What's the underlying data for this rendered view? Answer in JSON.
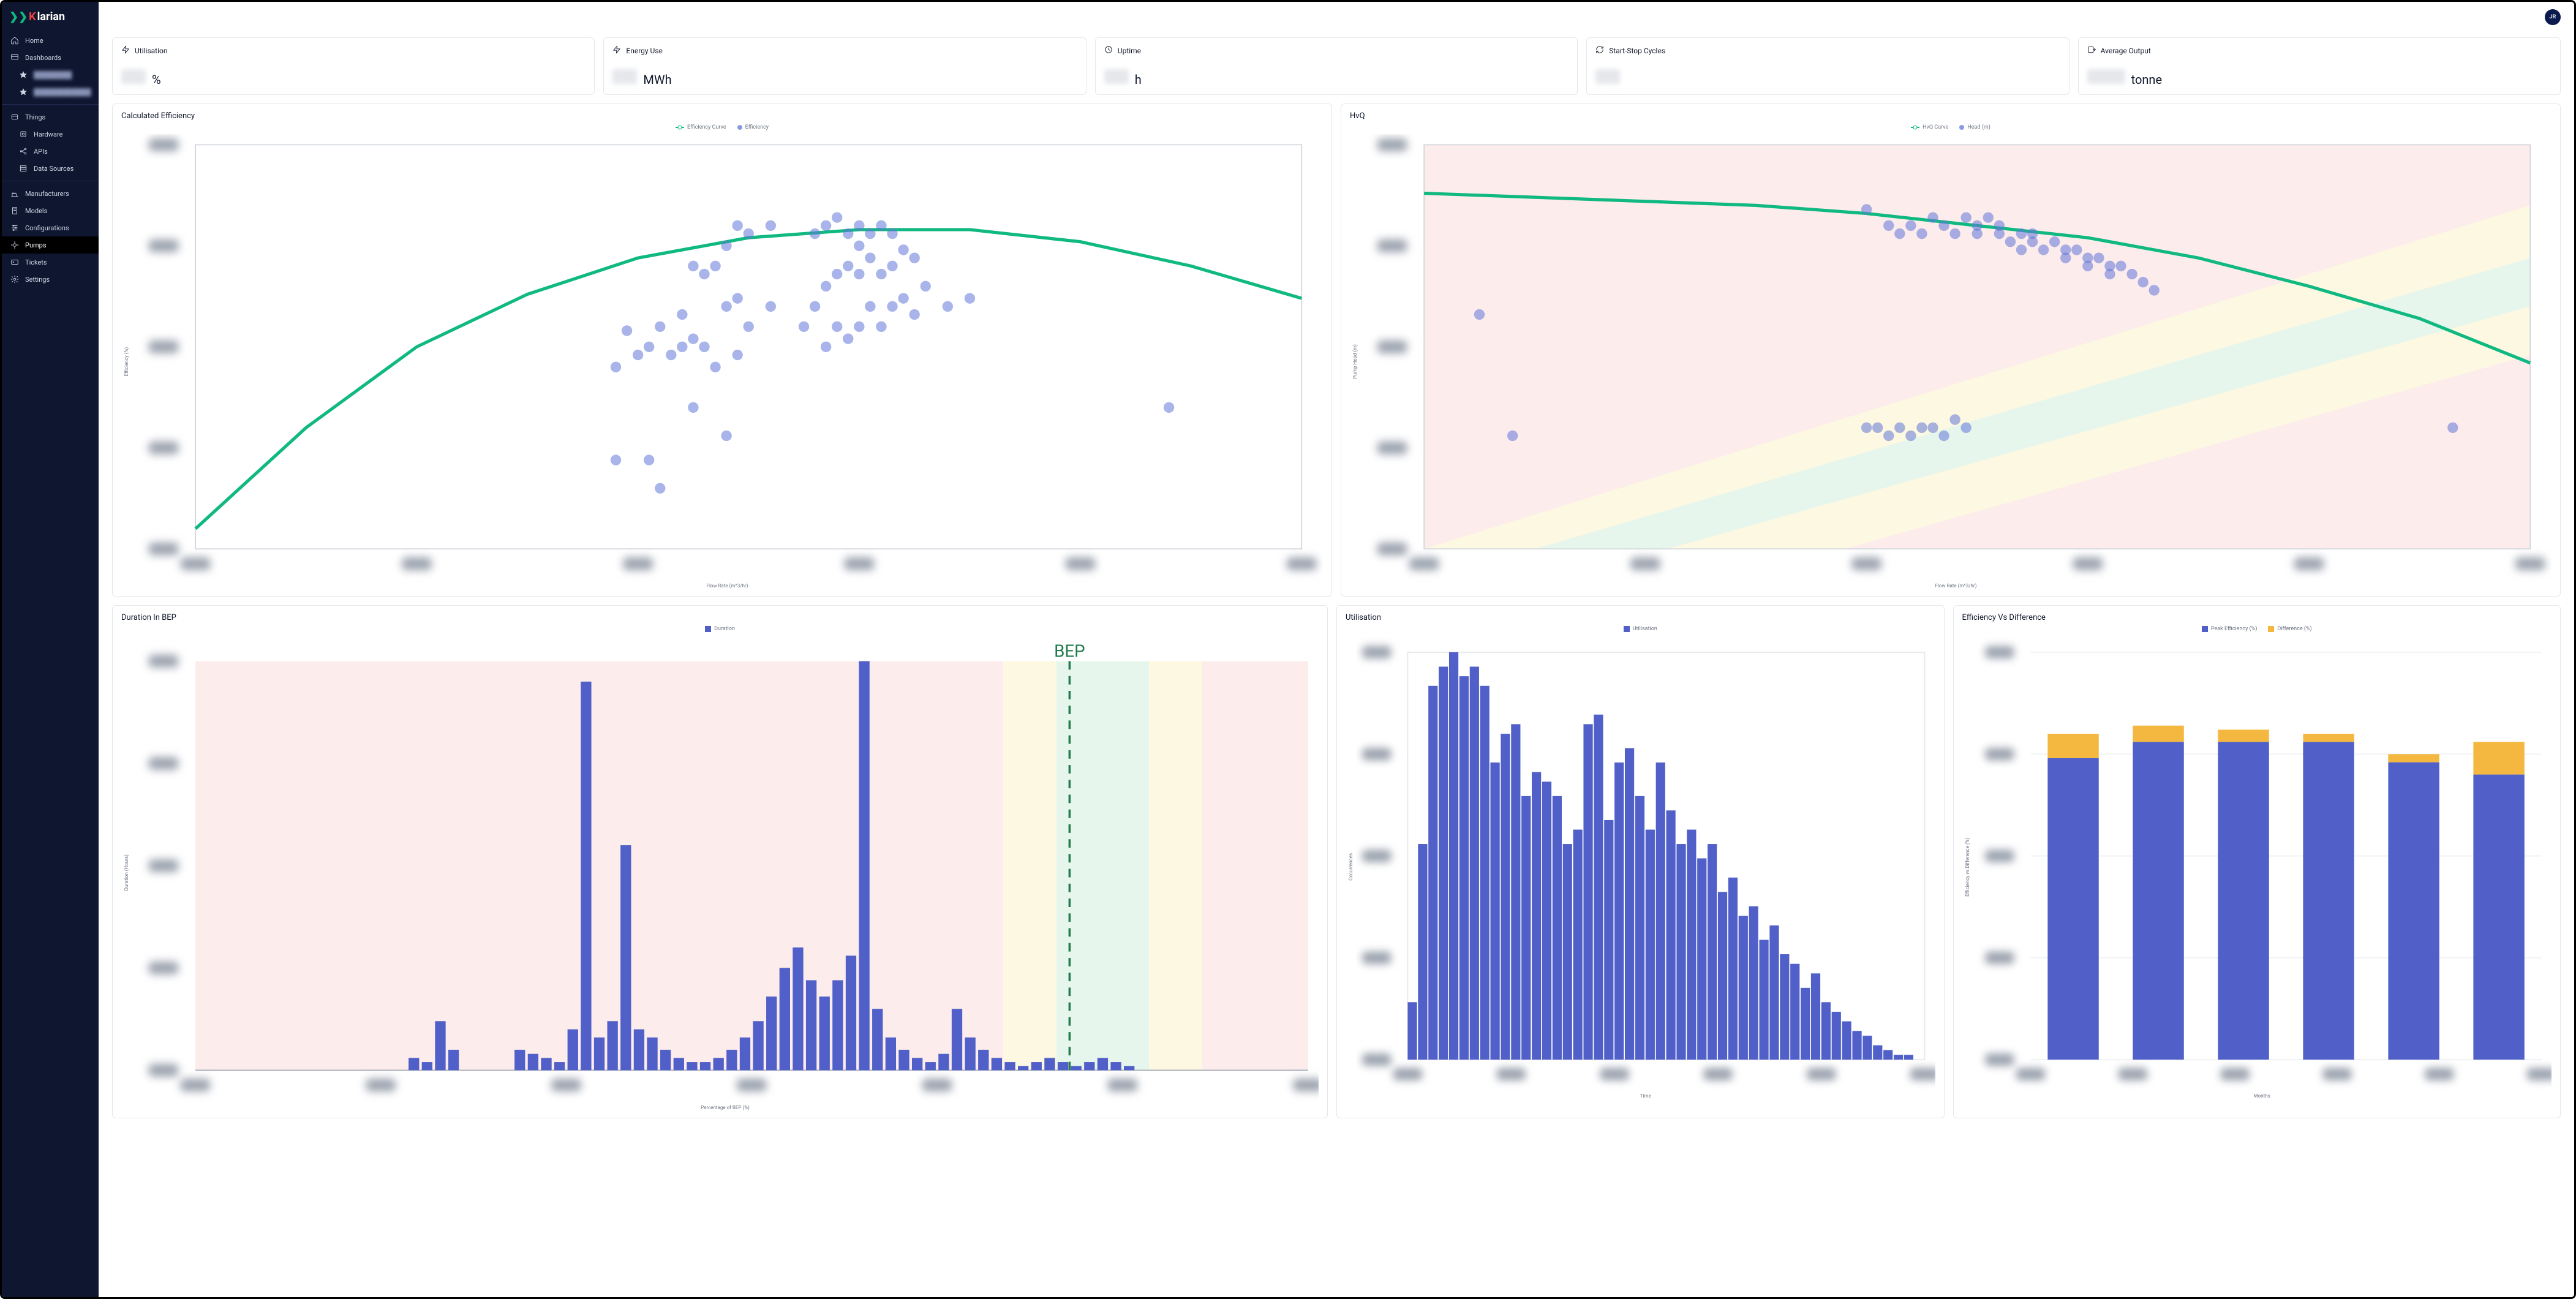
{
  "brand": {
    "chevrons": "❯❯",
    "k": "K",
    "rest": "larian"
  },
  "user": {
    "initials": "JR"
  },
  "sidebar": {
    "items": [
      {
        "name": "home",
        "label": "Home",
        "icon": "home"
      },
      {
        "name": "dashboards",
        "label": "Dashboards",
        "icon": "dashboard"
      },
      {
        "name": "fav-1",
        "label": "████████",
        "icon": "star",
        "sub": true,
        "blurred": true
      },
      {
        "name": "fav-2",
        "label": "████████████",
        "icon": "star",
        "sub": true,
        "blurred": true
      },
      {
        "name": "things",
        "label": "Things",
        "icon": "things"
      },
      {
        "name": "hardware",
        "label": "Hardware",
        "icon": "hardware",
        "sub": true
      },
      {
        "name": "apis",
        "label": "APIs",
        "icon": "api",
        "sub": true
      },
      {
        "name": "data-sources",
        "label": "Data Sources",
        "icon": "data",
        "sub": true
      },
      {
        "name": "manufacturers",
        "label": "Manufacturers",
        "icon": "manufacturers"
      },
      {
        "name": "models",
        "label": "Models",
        "icon": "models"
      },
      {
        "name": "configurations",
        "label": "Configurations",
        "icon": "config"
      },
      {
        "name": "pumps",
        "label": "Pumps",
        "icon": "pumps",
        "active": true
      },
      {
        "name": "tickets",
        "label": "Tickets",
        "icon": "tickets"
      },
      {
        "name": "settings",
        "label": "Settings",
        "icon": "settings"
      }
    ]
  },
  "kpis": [
    {
      "name": "utilisation",
      "label": "Utilisation",
      "icon": "bolt",
      "unit": "%"
    },
    {
      "name": "energy-use",
      "label": "Energy Use",
      "icon": "bolt",
      "unit": "MWh"
    },
    {
      "name": "uptime",
      "label": "Uptime",
      "icon": "clock",
      "unit": "h"
    },
    {
      "name": "start-stop",
      "label": "Start-Stop Cycles",
      "icon": "refresh",
      "unit": ""
    },
    {
      "name": "avg-output",
      "label": "Average Output",
      "icon": "output",
      "unit": "tonne",
      "wide": true
    }
  ],
  "charts": {
    "efficiency": {
      "title": "Calculated Efficiency",
      "legend": [
        "Efficiency Curve",
        "Efficiency"
      ],
      "xlabel": "Flow Rate (m^3/hr)",
      "ylabel": "Efficiency (%)"
    },
    "hvq": {
      "title": "HvQ",
      "legend": [
        "HvQ Curve",
        "Head (m)"
      ],
      "xlabel": "Flow Rate (m^3/hr)",
      "ylabel": "Pump Head (m)"
    },
    "bep": {
      "title": "Duration In BEP",
      "legend": [
        "Duration"
      ],
      "xlabel": "Percentage of BEP (%)",
      "ylabel": "Duration (Hours)",
      "marker": "BEP"
    },
    "util": {
      "title": "Utilisation",
      "legend": [
        "Utilisation"
      ],
      "xlabel": "Time",
      "ylabel": "Occurrences"
    },
    "effdiff": {
      "title": "Efficiency Vs Difference",
      "legend": [
        "Peak Efficiency (%)",
        "Difference (%)"
      ],
      "xlabel": "Months",
      "ylabel": "Efficiency vs Difference (%)"
    }
  },
  "colors": {
    "curve": "#10b981",
    "point": "#6177d8",
    "bar": "#5060c8",
    "diff": "#f4b840"
  },
  "chart_data": [
    {
      "id": "efficiency",
      "type": "scatter",
      "title": "Calculated Efficiency",
      "xlabel": "Flow Rate (m^3/hr)",
      "ylabel": "Efficiency (%)",
      "xlim": [
        0,
        100
      ],
      "ylim": [
        0,
        100
      ],
      "series": [
        {
          "name": "Efficiency Curve",
          "kind": "line",
          "x": [
            0,
            10,
            20,
            30,
            40,
            50,
            60,
            70,
            80,
            90,
            100
          ],
          "y": [
            5,
            30,
            50,
            63,
            72,
            77,
            79,
            79,
            76,
            70,
            62
          ]
        },
        {
          "name": "Efficiency",
          "kind": "scatter",
          "x": [
            38,
            38,
            39,
            40,
            41,
            41,
            42,
            42,
            43,
            44,
            44,
            45,
            45,
            45,
            46,
            46,
            47,
            47,
            48,
            48,
            48,
            49,
            49,
            49,
            50,
            50,
            52,
            52,
            55,
            56,
            56,
            57,
            57,
            57,
            58,
            58,
            58,
            59,
            59,
            59,
            60,
            60,
            60,
            60,
            61,
            61,
            61,
            62,
            62,
            62,
            63,
            63,
            63,
            64,
            64,
            65,
            65,
            66,
            68,
            70,
            88
          ],
          "y": [
            22,
            45,
            54,
            48,
            22,
            50,
            15,
            55,
            48,
            50,
            58,
            35,
            52,
            70,
            50,
            68,
            45,
            70,
            28,
            60,
            75,
            48,
            62,
            80,
            55,
            78,
            60,
            80,
            55,
            60,
            78,
            50,
            65,
            80,
            55,
            68,
            82,
            52,
            70,
            78,
            55,
            68,
            75,
            80,
            60,
            72,
            78,
            55,
            68,
            80,
            60,
            70,
            78,
            62,
            74,
            58,
            72,
            65,
            60,
            62,
            35
          ]
        }
      ]
    },
    {
      "id": "hvq",
      "type": "scatter",
      "title": "HvQ",
      "xlabel": "Flow Rate (m^3/hr)",
      "ylabel": "Pump Head (m)",
      "xlim": [
        0,
        100
      ],
      "ylim": [
        0,
        100
      ],
      "series": [
        {
          "name": "HvQ Curve",
          "kind": "line",
          "x": [
            0,
            10,
            20,
            30,
            40,
            50,
            60,
            70,
            80,
            90,
            100
          ],
          "y": [
            88,
            87,
            86,
            85,
            83,
            80,
            77,
            72,
            65,
            57,
            46
          ]
        },
        {
          "name": "Head (m)",
          "kind": "scatter",
          "x": [
            5,
            8,
            40,
            40,
            41,
            42,
            42,
            43,
            43,
            44,
            44,
            45,
            45,
            46,
            46,
            47,
            47,
            48,
            48,
            49,
            49,
            50,
            50,
            51,
            52,
            52,
            53,
            54,
            54,
            55,
            55,
            56,
            57,
            58,
            58,
            59,
            60,
            60,
            61,
            62,
            62,
            63,
            64,
            65,
            66,
            93
          ],
          "y": [
            58,
            28,
            30,
            84,
            30,
            28,
            80,
            30,
            78,
            28,
            80,
            30,
            78,
            30,
            82,
            28,
            80,
            32,
            78,
            82,
            30,
            80,
            78,
            82,
            78,
            80,
            76,
            78,
            74,
            76,
            78,
            74,
            76,
            74,
            72,
            74,
            72,
            70,
            72,
            70,
            68,
            70,
            68,
            66,
            64,
            30
          ]
        }
      ]
    },
    {
      "id": "bep",
      "type": "bar",
      "title": "Duration In BEP",
      "xlabel": "Percentage of BEP (%)",
      "ylabel": "Duration (Hours)",
      "categories_range": [
        0,
        100
      ],
      "series": [
        {
          "name": "Duration",
          "values": [
            0,
            0,
            0,
            0,
            0,
            0,
            0,
            0,
            0,
            0,
            0,
            0,
            0,
            0,
            0,
            0,
            3,
            2,
            12,
            5,
            0,
            0,
            0,
            0,
            5,
            4,
            3,
            2,
            10,
            95,
            8,
            12,
            55,
            10,
            8,
            5,
            3,
            2,
            2,
            3,
            5,
            8,
            12,
            18,
            25,
            30,
            22,
            18,
            22,
            28,
            100,
            15,
            8,
            5,
            3,
            2,
            4,
            15,
            8,
            5,
            3,
            2,
            1,
            2,
            3,
            2,
            1,
            2,
            3,
            2,
            1,
            0,
            0,
            0,
            0,
            0,
            0,
            0,
            0,
            0,
            0,
            0,
            0,
            0
          ]
        }
      ],
      "annotations": [
        {
          "type": "vline",
          "x_index": 66,
          "label": "BEP"
        }
      ],
      "bands": [
        {
          "from": 0,
          "to": 61,
          "color": "#fdecec"
        },
        {
          "from": 61,
          "to": 65,
          "color": "#fdf8e1"
        },
        {
          "from": 65,
          "to": 72,
          "color": "#e7f6ec"
        },
        {
          "from": 72,
          "to": 76,
          "color": "#fdf8e1"
        },
        {
          "from": 76,
          "to": 84,
          "color": "#fdecec"
        }
      ]
    },
    {
      "id": "util",
      "type": "bar",
      "title": "Utilisation",
      "xlabel": "Time",
      "ylabel": "Occurrences",
      "series": [
        {
          "name": "Utilisation",
          "values": [
            12,
            45,
            78,
            82,
            85,
            80,
            82,
            78,
            62,
            68,
            70,
            55,
            60,
            58,
            55,
            45,
            48,
            70,
            72,
            50,
            62,
            65,
            55,
            48,
            62,
            52,
            45,
            48,
            42,
            45,
            35,
            38,
            30,
            32,
            25,
            28,
            22,
            20,
            15,
            18,
            12,
            10,
            8,
            6,
            5,
            3,
            2,
            1,
            1,
            0
          ]
        }
      ]
    },
    {
      "id": "effdiff",
      "type": "bar",
      "title": "Efficiency Vs Difference",
      "xlabel": "Months",
      "ylabel": "Efficiency vs Difference (%)",
      "ylim": [
        0,
        100
      ],
      "stacked": true,
      "categories": [
        "M1",
        "M2",
        "M3",
        "M4",
        "M5",
        "M6"
      ],
      "series": [
        {
          "name": "Peak Efficiency (%)",
          "values": [
            74,
            78,
            78,
            78,
            73,
            70
          ]
        },
        {
          "name": "Difference (%)",
          "values": [
            6,
            4,
            3,
            2,
            2,
            8
          ]
        }
      ]
    }
  ]
}
